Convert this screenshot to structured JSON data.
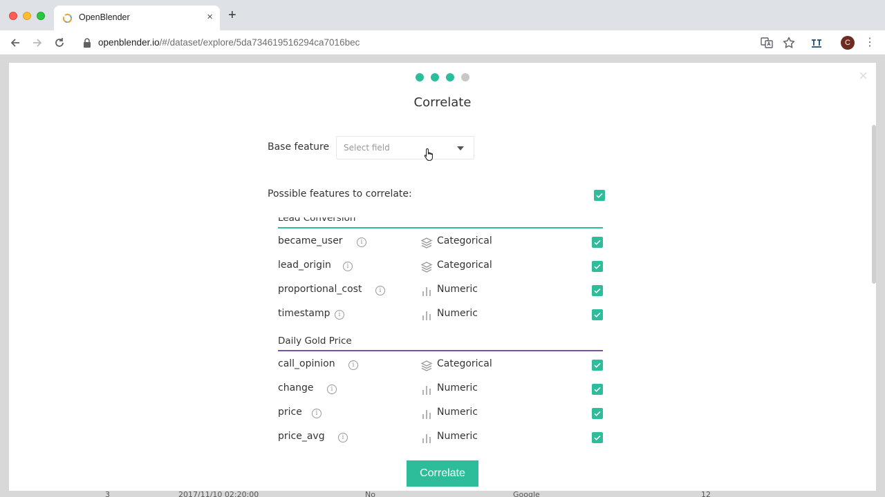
{
  "browser": {
    "tab_title": "OpenBlender",
    "tab_close": "×",
    "new_tab": "+",
    "url_host": "openblender.io",
    "url_path": "/#/dataset/explore/5da734619516294ca7016bec",
    "avatar_letter": "C",
    "menu": "⋮"
  },
  "background_row": {
    "cells": [
      "3",
      "2017/11/10 02:20:00",
      "No",
      "Google",
      "12"
    ]
  },
  "modal": {
    "close": "×",
    "steps": [
      {
        "state": "done",
        "color": "#2ebd9b"
      },
      {
        "state": "done",
        "color": "#2ebd9b"
      },
      {
        "state": "done",
        "color": "#2ebd9b"
      },
      {
        "state": "pending",
        "color": "#c8c8c8"
      }
    ],
    "title": "Correlate",
    "base_feature": {
      "label": "Base feature",
      "placeholder": "Select field"
    },
    "possible_label": "Possible features to correlate:",
    "select_all_checked": true,
    "groups": [
      {
        "name": "Lead Conversion",
        "color": "#2ebd9b",
        "features": [
          {
            "name": "became_user",
            "type": "Categorical",
            "icon": "layers-icon",
            "checked": true
          },
          {
            "name": "lead_origin",
            "type": "Categorical",
            "icon": "layers-icon",
            "checked": true
          },
          {
            "name": "proportional_cost",
            "type": "Numeric",
            "icon": "bar-chart-icon",
            "checked": true
          },
          {
            "name": "timestamp",
            "type": "Numeric",
            "icon": "bar-chart-icon",
            "checked": true
          }
        ]
      },
      {
        "name": "Daily Gold Price",
        "color": "#7b4fa8",
        "features": [
          {
            "name": "call_opinion",
            "type": "Categorical",
            "icon": "layers-icon",
            "checked": true
          },
          {
            "name": "change",
            "type": "Numeric",
            "icon": "bar-chart-icon",
            "checked": true
          },
          {
            "name": "price",
            "type": "Numeric",
            "icon": "bar-chart-icon",
            "checked": true
          },
          {
            "name": "price_avg",
            "type": "Numeric",
            "icon": "bar-chart-icon",
            "checked": true
          }
        ]
      }
    ],
    "submit_label": "Correlate",
    "accent_color": "#2ebd9b"
  }
}
